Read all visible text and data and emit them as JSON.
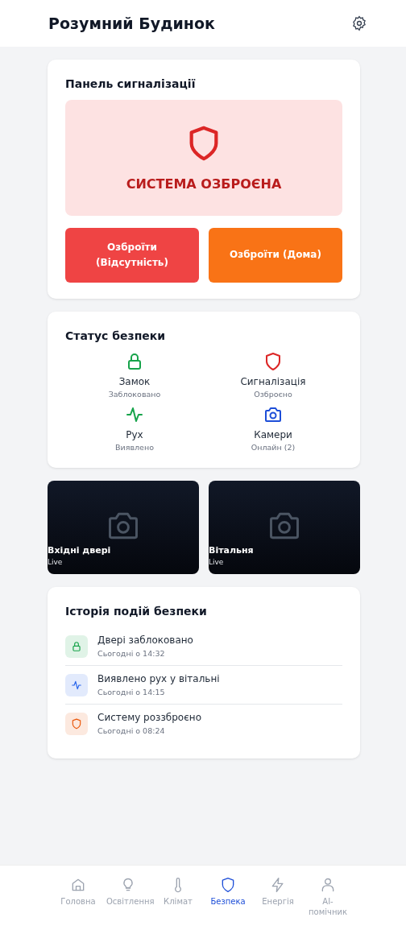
{
  "header": {
    "title": "Розумний Будинок"
  },
  "alarm_panel": {
    "title": "Панель сигналізації",
    "status": "СИСТЕМА ОЗБРОЄНА",
    "armed": true,
    "buttons": [
      {
        "label": "Озброїти (Відсутність)",
        "color": "#ef4444"
      },
      {
        "label": "Озброїти (Дома)",
        "color": "#f97316"
      }
    ]
  },
  "security_status": {
    "title": "Статус безпеки",
    "items": [
      {
        "kind": "lock",
        "label": "Замок",
        "value": "Заблоковано",
        "color": "#16a34a"
      },
      {
        "kind": "shield",
        "label": "Сигналізація",
        "value": "Озброєно",
        "color": "#dc2626"
      },
      {
        "kind": "activity",
        "label": "Рух",
        "value": "Виявлено",
        "color": "#16a34a"
      },
      {
        "kind": "camera",
        "label": "Камери",
        "value": "Онлайн (2)",
        "color": "#1d4ed8"
      }
    ]
  },
  "cameras": [
    {
      "name": "Вхідні двері",
      "status": "Live"
    },
    {
      "name": "Вітальня",
      "status": "Live"
    }
  ],
  "event_history": {
    "title": "Історія подій безпеки",
    "events": [
      {
        "kind": "lock",
        "text": "Двері заблоковано",
        "time": "Сьогодні о 14:32",
        "color": "#16a34a"
      },
      {
        "kind": "activity",
        "text": "Виявлено рух у вітальні",
        "time": "Сьогодні о 14:15",
        "color": "#2563eb"
      },
      {
        "kind": "shield",
        "text": "Систему роззброєно",
        "time": "Сьогодні о 08:24",
        "color": "#ea580c"
      }
    ]
  },
  "bottom_nav": [
    {
      "kind": "home",
      "label": "Головна",
      "selected": false
    },
    {
      "kind": "bulb",
      "label": "Освітлення",
      "selected": false
    },
    {
      "kind": "thermometer",
      "label": "Клімат",
      "selected": false
    },
    {
      "kind": "shield",
      "label": "Безпека",
      "selected": true
    },
    {
      "kind": "zap",
      "label": "Енергія",
      "selected": false
    },
    {
      "kind": "user",
      "label": "AI-помічник",
      "selected": false
    }
  ]
}
